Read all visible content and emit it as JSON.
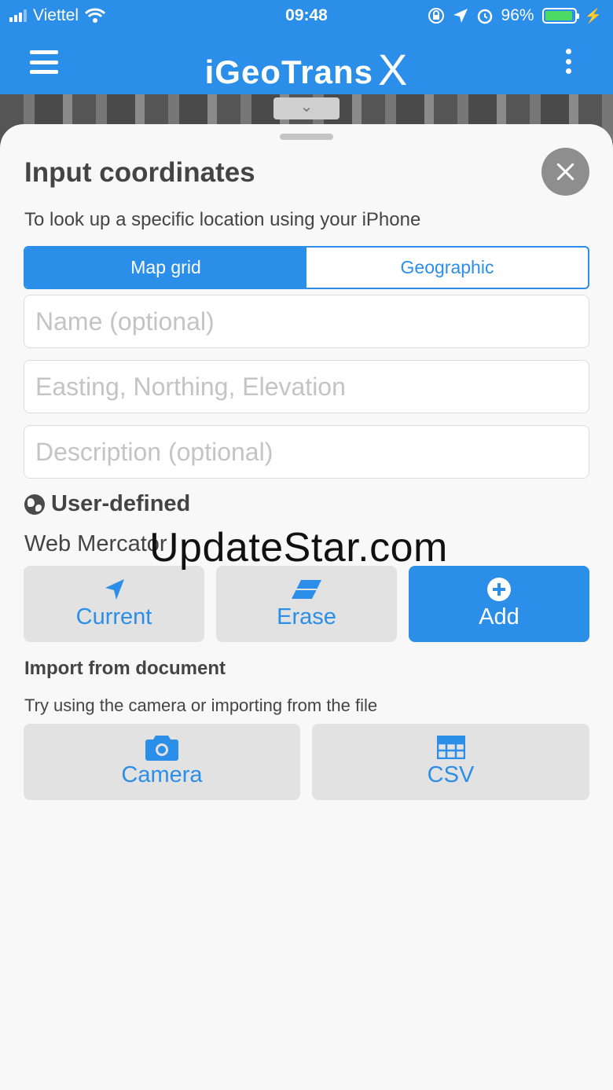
{
  "status_bar": {
    "carrier": "Viettel",
    "time": "09:48",
    "battery_percent": "96%",
    "battery_level": 0.96
  },
  "app_bar": {
    "title": "iGeoTrans",
    "title_suffix": "X",
    "accent_color": "#2b8ee8"
  },
  "sheet": {
    "title": "Input coordinates",
    "subtitle": "To look up a specific location using your iPhone",
    "segments": [
      {
        "label": "Map grid",
        "active": true
      },
      {
        "label": "Geographic",
        "active": false
      }
    ],
    "fields": {
      "name_placeholder": "Name (optional)",
      "coords_placeholder": "Easting, Northing, Elevation",
      "description_placeholder": "Description (optional)"
    },
    "coordinate_system": {
      "label": "User-defined",
      "projection": "Web Mercator"
    },
    "actions": {
      "current": "Current",
      "erase": "Erase",
      "add": "Add"
    },
    "import": {
      "title": "Import from document",
      "subtitle": "Try using the camera or importing from the file",
      "camera": "Camera",
      "csv": "CSV"
    }
  },
  "watermark": "UpdateStar.com"
}
